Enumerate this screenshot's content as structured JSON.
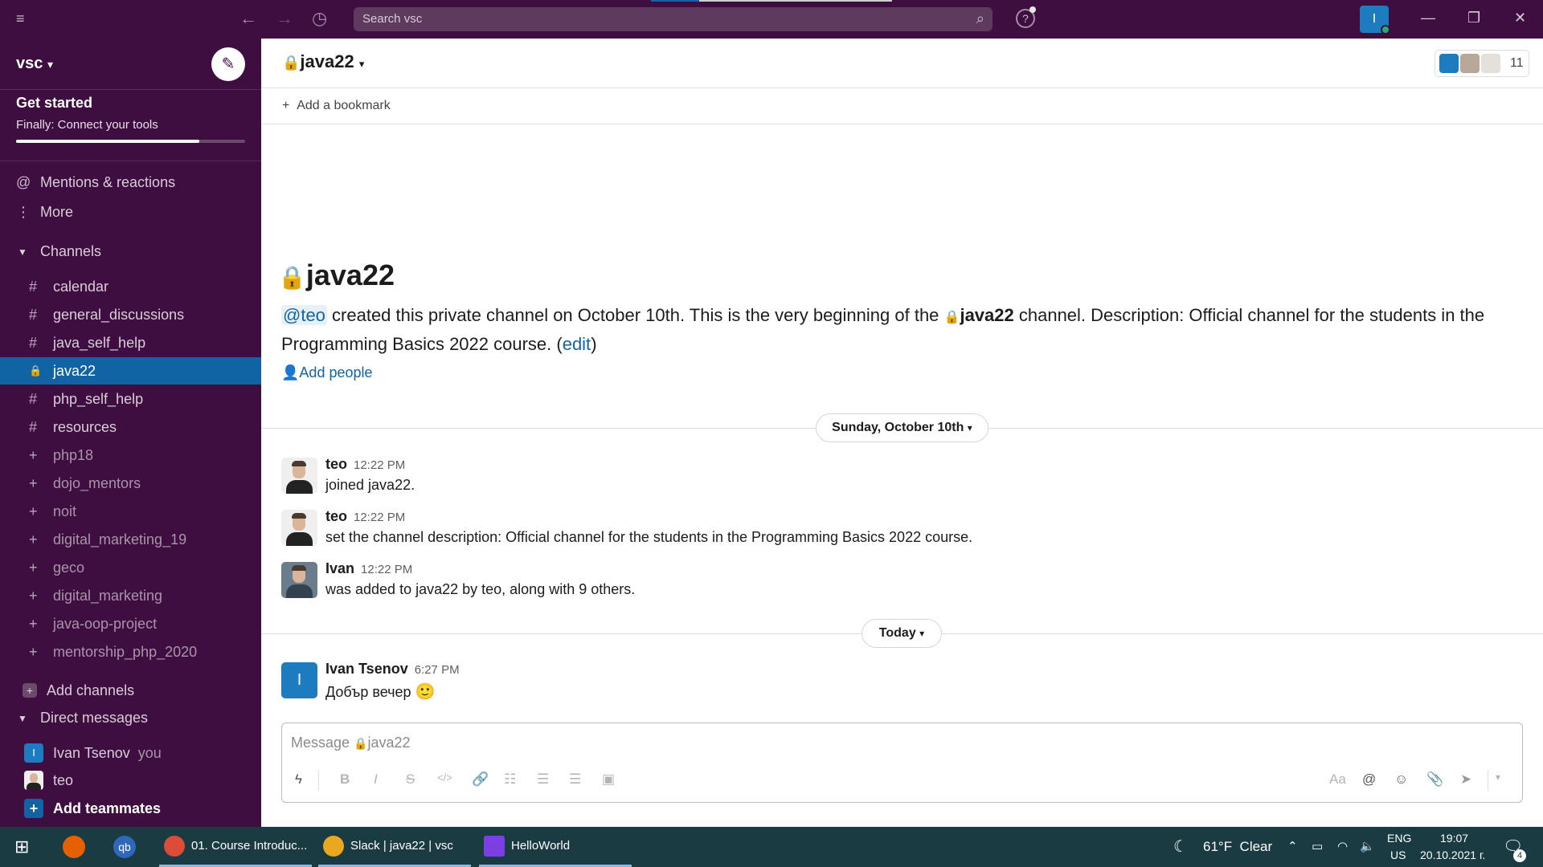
{
  "search": {
    "placeholder": "Search vsc"
  },
  "workspace": {
    "name": "vsc",
    "caret": "⌄"
  },
  "get_started": {
    "title": "Get started",
    "subtitle": "Finally: Connect your tools",
    "progress": 0.8
  },
  "nav": [
    {
      "icon": "@",
      "label": "Mentions & reactions"
    },
    {
      "icon": "⋮",
      "label": "More"
    }
  ],
  "channels_section": {
    "label": "Channels"
  },
  "channels": [
    {
      "icon": "#",
      "label": "calendar",
      "state": "normal"
    },
    {
      "icon": "#",
      "label": "general_discussions",
      "state": "normal"
    },
    {
      "icon": "#",
      "label": "java_self_help",
      "state": "normal"
    },
    {
      "icon": "🔒",
      "label": "java22",
      "state": "active"
    },
    {
      "icon": "#",
      "label": "php_self_help",
      "state": "normal"
    },
    {
      "icon": "#",
      "label": "resources",
      "state": "normal"
    },
    {
      "icon": "+",
      "label": "php18",
      "state": "muted"
    },
    {
      "icon": "+",
      "label": "dojo_mentors",
      "state": "muted"
    },
    {
      "icon": "+",
      "label": "noit",
      "state": "muted"
    },
    {
      "icon": "+",
      "label": "digital_marketing_19",
      "state": "muted"
    },
    {
      "icon": "+",
      "label": "geco",
      "state": "muted"
    },
    {
      "icon": "+",
      "label": "digital_marketing",
      "state": "muted"
    },
    {
      "icon": "+",
      "label": "java-oop-project",
      "state": "muted"
    },
    {
      "icon": "+",
      "label": "mentorship_php_2020",
      "state": "muted"
    }
  ],
  "add_channels": "Add channels",
  "dm_section": {
    "label": "Direct messages"
  },
  "dms": [
    {
      "name": "Ivan Tsenov",
      "suffix": "you",
      "avatar_letter": "I"
    },
    {
      "name": "teo",
      "suffix": "",
      "avatar_letter": ""
    }
  ],
  "add_teammates": "Add teammates",
  "header": {
    "channel": "java22",
    "member_count": "11",
    "me_letter": "I",
    "bookmark": "Add a bookmark"
  },
  "intro": {
    "title": "java22",
    "mention": "@teo",
    "text1": " created this private channel on October 10th. This is the very beginning of the ",
    "channel": "java22",
    "text2": " channel. Description: Official channel for the students in the Programming Basics 2022 course. (",
    "edit": "edit",
    "text3": ")",
    "add_people": "Add people"
  },
  "day1": "Sunday, October 10th",
  "day2": "Today",
  "messages": [
    {
      "author": "teo",
      "time": "12:22 PM",
      "text": "joined java22."
    },
    {
      "author": "teo",
      "time": "12:22 PM",
      "text": "set the channel description: Official channel for the students in the Programming Basics 2022 course."
    },
    {
      "author": "Ivan",
      "time": "12:22 PM",
      "text": "was added to java22 by teo, along with 9 others."
    },
    {
      "author": "Ivan Tsenov",
      "time": "6:27 PM",
      "text": "Добър вечер",
      "avatar_letter": "I",
      "emoji": "🙂"
    }
  ],
  "composer": {
    "placeholder_prefix": "Message ",
    "placeholder_channel": "java22",
    "format_label": "Aa"
  },
  "taskbar": {
    "apps": [
      {
        "label": "01. Course Introduc...",
        "color": "#dd4b39"
      },
      {
        "label": "Slack | java22 | vsc",
        "color": "#e9a820"
      },
      {
        "label": "HelloWorld",
        "color": "#7b3fe4"
      }
    ],
    "qb_label": "qb",
    "weather": "61°F  Clear",
    "lang1": "ENG",
    "lang2": "US",
    "time": "19:07",
    "date": "20.10.2021 г.",
    "notif_count": "4"
  },
  "colors": {
    "sidebar": "#3f0e40",
    "active": "#1164a3",
    "link": "#1264a3"
  }
}
